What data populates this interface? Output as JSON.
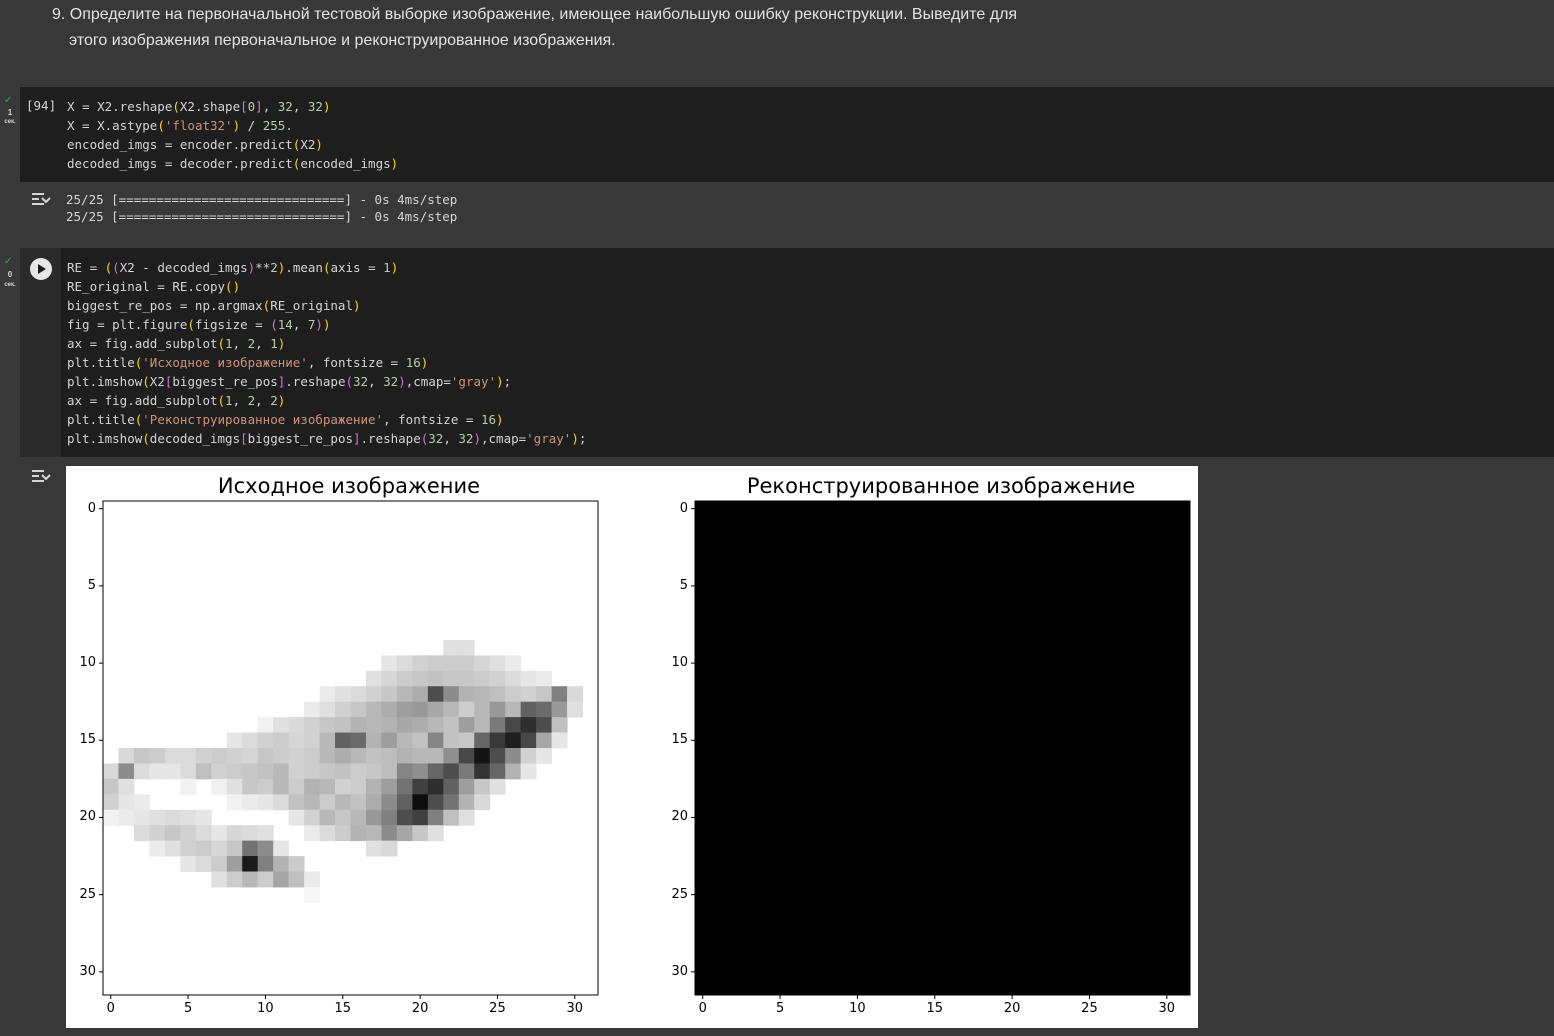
{
  "markdown": {
    "line1": "9. Определите на первоначальной тестовой выборке изображение, имеющее наибольшую ошибку реконструкции. Выведите для",
    "line2": "этого изображения первоначальное и реконструированное изображения."
  },
  "cell1": {
    "exec_count": "[94]",
    "duration_num": "1",
    "duration_unit": "сек.",
    "code": [
      "X = X2.reshape(X2.shape[0], 32, 32)",
      "X = X.astype('float32') / 255.",
      "encoded_imgs = encoder.predict(X2)",
      "decoded_imgs = decoder.predict(encoded_imgs)"
    ],
    "output": [
      "25/25 [==============================] - 0s 4ms/step",
      "25/25 [==============================] - 0s 4ms/step"
    ]
  },
  "cell2": {
    "duration_num": "0",
    "duration_unit": "сек.",
    "code": [
      "RE = ((X2 - decoded_imgs)**2).mean(axis = 1)",
      "RE_original = RE.copy()",
      "biggest_re_pos = np.argmax(RE_original)",
      "fig = plt.figure(figsize = (14, 7))",
      "ax = fig.add_subplot(1, 2, 1)",
      "plt.title('Исходное изображение', fontsize = 16)",
      "plt.imshow(X2[biggest_re_pos].reshape(32, 32),cmap='gray');",
      "ax = fig.add_subplot(1, 2, 2)",
      "plt.title('Реконструированное изображение', fontsize = 16)",
      "plt.imshow(decoded_imgs[biggest_re_pos].reshape(32, 32),cmap='gray');"
    ]
  },
  "chart_data": [
    {
      "type": "heatmap",
      "title": "Исходное изображение",
      "colormap": "gray",
      "size": [
        32,
        32
      ],
      "xticks": [
        0,
        5,
        10,
        15,
        20,
        25,
        30
      ],
      "yticks": [
        0,
        5,
        10,
        15,
        20,
        25,
        30
      ],
      "xlim": [
        -0.5,
        31.5
      ],
      "ylim": [
        31.5,
        -0.5
      ],
      "dark_pixels": [
        [
          9,
          22,
          0.88
        ],
        [
          9,
          23,
          0.88
        ],
        [
          10,
          18,
          0.9
        ],
        [
          10,
          19,
          0.86
        ],
        [
          10,
          20,
          0.82
        ],
        [
          10,
          21,
          0.8
        ],
        [
          10,
          22,
          0.8
        ],
        [
          10,
          23,
          0.8
        ],
        [
          10,
          24,
          0.84
        ],
        [
          10,
          25,
          0.88
        ],
        [
          10,
          26,
          0.92
        ],
        [
          11,
          17,
          0.88
        ],
        [
          11,
          18,
          0.84
        ],
        [
          11,
          19,
          0.8
        ],
        [
          11,
          20,
          0.78
        ],
        [
          11,
          21,
          0.76
        ],
        [
          11,
          22,
          0.78
        ],
        [
          11,
          23,
          0.78
        ],
        [
          11,
          24,
          0.8
        ],
        [
          11,
          25,
          0.82
        ],
        [
          11,
          26,
          0.86
        ],
        [
          11,
          27,
          0.9
        ],
        [
          11,
          28,
          0.92
        ],
        [
          12,
          14,
          0.92
        ],
        [
          12,
          15,
          0.88
        ],
        [
          12,
          16,
          0.86
        ],
        [
          12,
          17,
          0.82
        ],
        [
          12,
          18,
          0.78
        ],
        [
          12,
          19,
          0.72
        ],
        [
          12,
          20,
          0.68
        ],
        [
          12,
          21,
          0.3
        ],
        [
          12,
          22,
          0.55
        ],
        [
          12,
          23,
          0.7
        ],
        [
          12,
          24,
          0.72
        ],
        [
          12,
          25,
          0.75
        ],
        [
          12,
          26,
          0.8
        ],
        [
          12,
          27,
          0.82
        ],
        [
          12,
          28,
          0.78
        ],
        [
          12,
          29,
          0.5
        ],
        [
          12,
          30,
          0.85
        ],
        [
          13,
          13,
          0.92
        ],
        [
          13,
          14,
          0.88
        ],
        [
          13,
          15,
          0.82
        ],
        [
          13,
          16,
          0.78
        ],
        [
          13,
          17,
          0.72
        ],
        [
          13,
          18,
          0.68
        ],
        [
          13,
          19,
          0.62
        ],
        [
          13,
          20,
          0.6
        ],
        [
          13,
          21,
          0.66
        ],
        [
          13,
          22,
          0.72
        ],
        [
          13,
          23,
          0.8
        ],
        [
          13,
          24,
          0.72
        ],
        [
          13,
          25,
          0.6
        ],
        [
          13,
          26,
          0.72
        ],
        [
          13,
          27,
          0.38
        ],
        [
          13,
          28,
          0.42
        ],
        [
          13,
          29,
          0.6
        ],
        [
          13,
          30,
          0.88
        ],
        [
          14,
          10,
          0.95
        ],
        [
          14,
          11,
          0.88
        ],
        [
          14,
          12,
          0.85
        ],
        [
          14,
          13,
          0.82
        ],
        [
          14,
          14,
          0.78
        ],
        [
          14,
          15,
          0.76
        ],
        [
          14,
          16,
          0.7
        ],
        [
          14,
          17,
          0.72
        ],
        [
          14,
          18,
          0.7
        ],
        [
          14,
          19,
          0.66
        ],
        [
          14,
          20,
          0.68
        ],
        [
          14,
          21,
          0.72
        ],
        [
          14,
          22,
          0.76
        ],
        [
          14,
          23,
          0.62
        ],
        [
          14,
          24,
          0.72
        ],
        [
          14,
          25,
          0.48
        ],
        [
          14,
          26,
          0.28
        ],
        [
          14,
          27,
          0.18
        ],
        [
          14,
          28,
          0.3
        ],
        [
          14,
          29,
          0.75
        ],
        [
          15,
          8,
          0.9
        ],
        [
          15,
          9,
          0.86
        ],
        [
          15,
          10,
          0.82
        ],
        [
          15,
          11,
          0.8
        ],
        [
          15,
          12,
          0.84
        ],
        [
          15,
          13,
          0.82
        ],
        [
          15,
          14,
          0.72
        ],
        [
          15,
          15,
          0.38
        ],
        [
          15,
          16,
          0.42
        ],
        [
          15,
          17,
          0.7
        ],
        [
          15,
          18,
          0.62
        ],
        [
          15,
          19,
          0.72
        ],
        [
          15,
          20,
          0.76
        ],
        [
          15,
          21,
          0.52
        ],
        [
          15,
          22,
          0.76
        ],
        [
          15,
          23,
          0.78
        ],
        [
          15,
          24,
          0.4
        ],
        [
          15,
          25,
          0.22
        ],
        [
          15,
          26,
          0.12
        ],
        [
          15,
          27,
          0.28
        ],
        [
          15,
          28,
          0.65
        ],
        [
          15,
          29,
          0.9
        ],
        [
          16,
          1,
          0.85
        ],
        [
          16,
          2,
          0.78
        ],
        [
          16,
          3,
          0.8
        ],
        [
          16,
          4,
          0.86
        ],
        [
          16,
          5,
          0.86
        ],
        [
          16,
          6,
          0.82
        ],
        [
          16,
          7,
          0.8
        ],
        [
          16,
          8,
          0.82
        ],
        [
          16,
          9,
          0.84
        ],
        [
          16,
          10,
          0.78
        ],
        [
          16,
          11,
          0.8
        ],
        [
          16,
          12,
          0.82
        ],
        [
          16,
          13,
          0.8
        ],
        [
          16,
          14,
          0.72
        ],
        [
          16,
          15,
          0.68
        ],
        [
          16,
          16,
          0.72
        ],
        [
          16,
          17,
          0.76
        ],
        [
          16,
          18,
          0.74
        ],
        [
          16,
          19,
          0.7
        ],
        [
          16,
          20,
          0.72
        ],
        [
          16,
          21,
          0.72
        ],
        [
          16,
          22,
          0.56
        ],
        [
          16,
          23,
          0.28
        ],
        [
          16,
          24,
          0.08
        ],
        [
          16,
          25,
          0.3
        ],
        [
          16,
          26,
          0.55
        ],
        [
          16,
          27,
          0.82
        ],
        [
          16,
          28,
          0.9
        ],
        [
          17,
          0,
          0.85
        ],
        [
          17,
          1,
          0.55
        ],
        [
          17,
          2,
          0.86
        ],
        [
          17,
          3,
          0.9
        ],
        [
          17,
          4,
          0.9
        ],
        [
          17,
          5,
          0.86
        ],
        [
          17,
          6,
          0.75
        ],
        [
          17,
          7,
          0.82
        ],
        [
          17,
          8,
          0.8
        ],
        [
          17,
          9,
          0.78
        ],
        [
          17,
          10,
          0.76
        ],
        [
          17,
          11,
          0.72
        ],
        [
          17,
          12,
          0.82
        ],
        [
          17,
          13,
          0.8
        ],
        [
          17,
          14,
          0.78
        ],
        [
          17,
          15,
          0.76
        ],
        [
          17,
          16,
          0.8
        ],
        [
          17,
          17,
          0.78
        ],
        [
          17,
          18,
          0.74
        ],
        [
          17,
          19,
          0.52
        ],
        [
          17,
          20,
          0.56
        ],
        [
          17,
          21,
          0.4
        ],
        [
          17,
          22,
          0.3
        ],
        [
          17,
          23,
          0.48
        ],
        [
          17,
          24,
          0.2
        ],
        [
          17,
          25,
          0.4
        ],
        [
          17,
          26,
          0.7
        ],
        [
          17,
          27,
          0.9
        ],
        [
          18,
          0,
          0.78
        ],
        [
          18,
          1,
          0.88
        ],
        [
          18,
          5,
          0.95
        ],
        [
          18,
          7,
          0.94
        ],
        [
          18,
          8,
          0.88
        ],
        [
          18,
          9,
          0.78
        ],
        [
          18,
          10,
          0.8
        ],
        [
          18,
          11,
          0.72
        ],
        [
          18,
          12,
          0.8
        ],
        [
          18,
          13,
          0.7
        ],
        [
          18,
          14,
          0.72
        ],
        [
          18,
          15,
          0.82
        ],
        [
          18,
          16,
          0.8
        ],
        [
          18,
          17,
          0.7
        ],
        [
          18,
          18,
          0.62
        ],
        [
          18,
          19,
          0.45
        ],
        [
          18,
          20,
          0.25
        ],
        [
          18,
          21,
          0.18
        ],
        [
          18,
          22,
          0.38
        ],
        [
          18,
          23,
          0.62
        ],
        [
          18,
          24,
          0.78
        ],
        [
          18,
          25,
          0.88
        ],
        [
          19,
          0,
          0.82
        ],
        [
          19,
          1,
          0.9
        ],
        [
          19,
          2,
          0.92
        ],
        [
          19,
          8,
          0.95
        ],
        [
          19,
          9,
          0.92
        ],
        [
          19,
          10,
          0.9
        ],
        [
          19,
          11,
          0.86
        ],
        [
          19,
          12,
          0.76
        ],
        [
          19,
          13,
          0.72
        ],
        [
          19,
          14,
          0.8
        ],
        [
          19,
          15,
          0.72
        ],
        [
          19,
          16,
          0.76
        ],
        [
          19,
          17,
          0.68
        ],
        [
          19,
          18,
          0.55
        ],
        [
          19,
          19,
          0.38
        ],
        [
          19,
          20,
          0.05
        ],
        [
          19,
          21,
          0.3
        ],
        [
          19,
          22,
          0.45
        ],
        [
          19,
          23,
          0.7
        ],
        [
          19,
          24,
          0.85
        ],
        [
          20,
          0,
          0.95
        ],
        [
          20,
          1,
          0.92
        ],
        [
          20,
          2,
          0.9
        ],
        [
          20,
          3,
          0.88
        ],
        [
          20,
          4,
          0.86
        ],
        [
          20,
          5,
          0.88
        ],
        [
          20,
          6,
          0.9
        ],
        [
          20,
          12,
          0.9
        ],
        [
          20,
          13,
          0.82
        ],
        [
          20,
          14,
          0.72
        ],
        [
          20,
          15,
          0.78
        ],
        [
          20,
          16,
          0.72
        ],
        [
          20,
          17,
          0.6
        ],
        [
          20,
          18,
          0.5
        ],
        [
          20,
          19,
          0.3
        ],
        [
          20,
          20,
          0.25
        ],
        [
          20,
          21,
          0.5
        ],
        [
          20,
          22,
          0.75
        ],
        [
          20,
          23,
          0.88
        ],
        [
          21,
          2,
          0.86
        ],
        [
          21,
          3,
          0.82
        ],
        [
          21,
          4,
          0.78
        ],
        [
          21,
          5,
          0.82
        ],
        [
          21,
          6,
          0.86
        ],
        [
          21,
          7,
          0.9
        ],
        [
          21,
          8,
          0.84
        ],
        [
          21,
          9,
          0.86
        ],
        [
          21,
          10,
          0.88
        ],
        [
          21,
          13,
          0.92
        ],
        [
          21,
          14,
          0.86
        ],
        [
          21,
          15,
          0.8
        ],
        [
          21,
          16,
          0.7
        ],
        [
          21,
          17,
          0.72
        ],
        [
          21,
          18,
          0.55
        ],
        [
          21,
          19,
          0.65
        ],
        [
          21,
          20,
          0.78
        ],
        [
          21,
          21,
          0.88
        ],
        [
          22,
          3,
          0.92
        ],
        [
          22,
          4,
          0.88
        ],
        [
          22,
          5,
          0.82
        ],
        [
          22,
          6,
          0.8
        ],
        [
          22,
          7,
          0.84
        ],
        [
          22,
          8,
          0.78
        ],
        [
          22,
          9,
          0.45
        ],
        [
          22,
          10,
          0.55
        ],
        [
          22,
          11,
          0.9
        ],
        [
          22,
          17,
          0.88
        ],
        [
          22,
          18,
          0.85
        ],
        [
          23,
          5,
          0.9
        ],
        [
          23,
          6,
          0.86
        ],
        [
          23,
          7,
          0.8
        ],
        [
          23,
          8,
          0.62
        ],
        [
          23,
          9,
          0.1
        ],
        [
          23,
          10,
          0.5
        ],
        [
          23,
          11,
          0.7
        ],
        [
          23,
          12,
          0.8
        ],
        [
          24,
          7,
          0.88
        ],
        [
          24,
          8,
          0.8
        ],
        [
          24,
          9,
          0.72
        ],
        [
          24,
          10,
          0.8
        ],
        [
          24,
          11,
          0.65
        ],
        [
          24,
          12,
          0.75
        ],
        [
          24,
          13,
          0.92
        ],
        [
          25,
          13,
          0.97
        ]
      ]
    },
    {
      "type": "heatmap",
      "title": "Реконструированное изображение",
      "colormap": "gray",
      "size": [
        32,
        32
      ],
      "fill_value": 0,
      "xticks": [
        0,
        5,
        10,
        15,
        20,
        25,
        30
      ],
      "yticks": [
        0,
        5,
        10,
        15,
        20,
        25,
        30
      ],
      "xlim": [
        -0.5,
        31.5
      ],
      "ylim": [
        31.5,
        -0.5
      ]
    }
  ]
}
